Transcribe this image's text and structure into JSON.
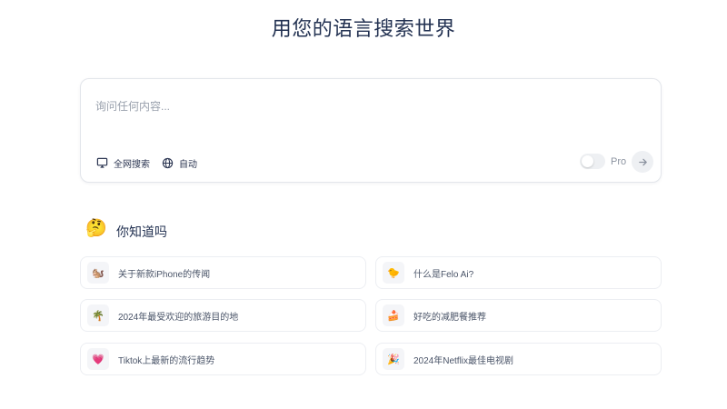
{
  "header": {
    "title": "用您的语言搜索世界"
  },
  "search": {
    "placeholder": "询问任何内容...",
    "value": "",
    "source_label": "全网搜索",
    "language_label": "自动",
    "pro_label": "Pro",
    "pro_enabled": false,
    "icons": {
      "source": "web-monitor-icon",
      "language": "globe-icon",
      "send": "arrow-right-icon"
    }
  },
  "did_you_know": {
    "emoji": "🤔",
    "title": "你知道吗",
    "items": [
      {
        "icon": "🐿️",
        "label": "关于新款iPhone的传闻"
      },
      {
        "icon": "🐤",
        "label": "什么是Felo Ai?"
      },
      {
        "icon": "🌴",
        "label": "2024年最受欢迎的旅游目的地"
      },
      {
        "icon": "🍰",
        "label": "好吃的减肥餐推荐"
      },
      {
        "icon": "💗",
        "label": "Tiktok上最新的流行趋势"
      },
      {
        "icon": "🎉",
        "label": "2024年Netflix最佳电视剧"
      }
    ]
  }
}
